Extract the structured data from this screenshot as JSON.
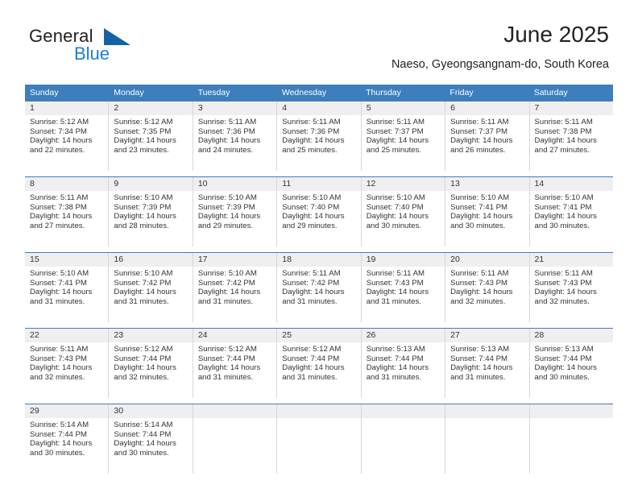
{
  "logo": {
    "primary_text": "General",
    "secondary_text": "Blue",
    "triangle_color": "#1464a5",
    "secondary_color": "#1b7fd4"
  },
  "header": {
    "title": "June 2025",
    "subtitle": "Naeso, Gyeongsangnam-do, South Korea"
  },
  "colors": {
    "header_row_bg": "#3d7ebd",
    "day_number_bg": "#efefef",
    "cell_divider": "#d7d7d7",
    "text": "#333333"
  },
  "weekdays": [
    "Sunday",
    "Monday",
    "Tuesday",
    "Wednesday",
    "Thursday",
    "Friday",
    "Saturday"
  ],
  "weeks": [
    [
      {
        "day": "1",
        "sunrise": "Sunrise: 5:12 AM",
        "sunset": "Sunset: 7:34 PM",
        "daylight1": "Daylight: 14 hours",
        "daylight2": "and 22 minutes."
      },
      {
        "day": "2",
        "sunrise": "Sunrise: 5:12 AM",
        "sunset": "Sunset: 7:35 PM",
        "daylight1": "Daylight: 14 hours",
        "daylight2": "and 23 minutes."
      },
      {
        "day": "3",
        "sunrise": "Sunrise: 5:11 AM",
        "sunset": "Sunset: 7:36 PM",
        "daylight1": "Daylight: 14 hours",
        "daylight2": "and 24 minutes."
      },
      {
        "day": "4",
        "sunrise": "Sunrise: 5:11 AM",
        "sunset": "Sunset: 7:36 PM",
        "daylight1": "Daylight: 14 hours",
        "daylight2": "and 25 minutes."
      },
      {
        "day": "5",
        "sunrise": "Sunrise: 5:11 AM",
        "sunset": "Sunset: 7:37 PM",
        "daylight1": "Daylight: 14 hours",
        "daylight2": "and 25 minutes."
      },
      {
        "day": "6",
        "sunrise": "Sunrise: 5:11 AM",
        "sunset": "Sunset: 7:37 PM",
        "daylight1": "Daylight: 14 hours",
        "daylight2": "and 26 minutes."
      },
      {
        "day": "7",
        "sunrise": "Sunrise: 5:11 AM",
        "sunset": "Sunset: 7:38 PM",
        "daylight1": "Daylight: 14 hours",
        "daylight2": "and 27 minutes."
      }
    ],
    [
      {
        "day": "8",
        "sunrise": "Sunrise: 5:11 AM",
        "sunset": "Sunset: 7:38 PM",
        "daylight1": "Daylight: 14 hours",
        "daylight2": "and 27 minutes."
      },
      {
        "day": "9",
        "sunrise": "Sunrise: 5:10 AM",
        "sunset": "Sunset: 7:39 PM",
        "daylight1": "Daylight: 14 hours",
        "daylight2": "and 28 minutes."
      },
      {
        "day": "10",
        "sunrise": "Sunrise: 5:10 AM",
        "sunset": "Sunset: 7:39 PM",
        "daylight1": "Daylight: 14 hours",
        "daylight2": "and 29 minutes."
      },
      {
        "day": "11",
        "sunrise": "Sunrise: 5:10 AM",
        "sunset": "Sunset: 7:40 PM",
        "daylight1": "Daylight: 14 hours",
        "daylight2": "and 29 minutes."
      },
      {
        "day": "12",
        "sunrise": "Sunrise: 5:10 AM",
        "sunset": "Sunset: 7:40 PM",
        "daylight1": "Daylight: 14 hours",
        "daylight2": "and 30 minutes."
      },
      {
        "day": "13",
        "sunrise": "Sunrise: 5:10 AM",
        "sunset": "Sunset: 7:41 PM",
        "daylight1": "Daylight: 14 hours",
        "daylight2": "and 30 minutes."
      },
      {
        "day": "14",
        "sunrise": "Sunrise: 5:10 AM",
        "sunset": "Sunset: 7:41 PM",
        "daylight1": "Daylight: 14 hours",
        "daylight2": "and 30 minutes."
      }
    ],
    [
      {
        "day": "15",
        "sunrise": "Sunrise: 5:10 AM",
        "sunset": "Sunset: 7:41 PM",
        "daylight1": "Daylight: 14 hours",
        "daylight2": "and 31 minutes."
      },
      {
        "day": "16",
        "sunrise": "Sunrise: 5:10 AM",
        "sunset": "Sunset: 7:42 PM",
        "daylight1": "Daylight: 14 hours",
        "daylight2": "and 31 minutes."
      },
      {
        "day": "17",
        "sunrise": "Sunrise: 5:10 AM",
        "sunset": "Sunset: 7:42 PM",
        "daylight1": "Daylight: 14 hours",
        "daylight2": "and 31 minutes."
      },
      {
        "day": "18",
        "sunrise": "Sunrise: 5:11 AM",
        "sunset": "Sunset: 7:42 PM",
        "daylight1": "Daylight: 14 hours",
        "daylight2": "and 31 minutes."
      },
      {
        "day": "19",
        "sunrise": "Sunrise: 5:11 AM",
        "sunset": "Sunset: 7:43 PM",
        "daylight1": "Daylight: 14 hours",
        "daylight2": "and 31 minutes."
      },
      {
        "day": "20",
        "sunrise": "Sunrise: 5:11 AM",
        "sunset": "Sunset: 7:43 PM",
        "daylight1": "Daylight: 14 hours",
        "daylight2": "and 32 minutes."
      },
      {
        "day": "21",
        "sunrise": "Sunrise: 5:11 AM",
        "sunset": "Sunset: 7:43 PM",
        "daylight1": "Daylight: 14 hours",
        "daylight2": "and 32 minutes."
      }
    ],
    [
      {
        "day": "22",
        "sunrise": "Sunrise: 5:11 AM",
        "sunset": "Sunset: 7:43 PM",
        "daylight1": "Daylight: 14 hours",
        "daylight2": "and 32 minutes."
      },
      {
        "day": "23",
        "sunrise": "Sunrise: 5:12 AM",
        "sunset": "Sunset: 7:44 PM",
        "daylight1": "Daylight: 14 hours",
        "daylight2": "and 32 minutes."
      },
      {
        "day": "24",
        "sunrise": "Sunrise: 5:12 AM",
        "sunset": "Sunset: 7:44 PM",
        "daylight1": "Daylight: 14 hours",
        "daylight2": "and 31 minutes."
      },
      {
        "day": "25",
        "sunrise": "Sunrise: 5:12 AM",
        "sunset": "Sunset: 7:44 PM",
        "daylight1": "Daylight: 14 hours",
        "daylight2": "and 31 minutes."
      },
      {
        "day": "26",
        "sunrise": "Sunrise: 5:13 AM",
        "sunset": "Sunset: 7:44 PM",
        "daylight1": "Daylight: 14 hours",
        "daylight2": "and 31 minutes."
      },
      {
        "day": "27",
        "sunrise": "Sunrise: 5:13 AM",
        "sunset": "Sunset: 7:44 PM",
        "daylight1": "Daylight: 14 hours",
        "daylight2": "and 31 minutes."
      },
      {
        "day": "28",
        "sunrise": "Sunrise: 5:13 AM",
        "sunset": "Sunset: 7:44 PM",
        "daylight1": "Daylight: 14 hours",
        "daylight2": "and 30 minutes."
      }
    ],
    [
      {
        "day": "29",
        "sunrise": "Sunrise: 5:14 AM",
        "sunset": "Sunset: 7:44 PM",
        "daylight1": "Daylight: 14 hours",
        "daylight2": "and 30 minutes."
      },
      {
        "day": "30",
        "sunrise": "Sunrise: 5:14 AM",
        "sunset": "Sunset: 7:44 PM",
        "daylight1": "Daylight: 14 hours",
        "daylight2": "and 30 minutes."
      },
      {
        "day": "",
        "sunrise": "",
        "sunset": "",
        "daylight1": "",
        "daylight2": ""
      },
      {
        "day": "",
        "sunrise": "",
        "sunset": "",
        "daylight1": "",
        "daylight2": ""
      },
      {
        "day": "",
        "sunrise": "",
        "sunset": "",
        "daylight1": "",
        "daylight2": ""
      },
      {
        "day": "",
        "sunrise": "",
        "sunset": "",
        "daylight1": "",
        "daylight2": ""
      },
      {
        "day": "",
        "sunrise": "",
        "sunset": "",
        "daylight1": "",
        "daylight2": ""
      }
    ]
  ]
}
